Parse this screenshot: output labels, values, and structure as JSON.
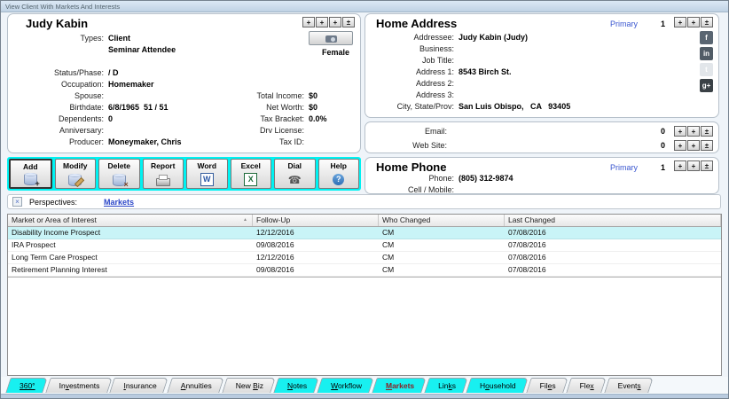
{
  "window": {
    "title": "View Client With Markets And Interests"
  },
  "colors": {
    "toolbar_bg": "#00f2f2",
    "tab_highlight": "#18f0f0",
    "selected_row_bg": "#c9f4f7",
    "primary_link": "#3b57d0",
    "perspective_link": "#2b46c8",
    "markets_tab_text": "#8b1f24"
  },
  "client": {
    "name": "Judy Kabin",
    "gender": "Female",
    "rows": [
      {
        "l1": "Types:",
        "v1": "Client"
      },
      {
        "l1": "",
        "v1": "Seminar Attendee"
      },
      {
        "spacer": true
      },
      {
        "l1": "Status/Phase:",
        "v1": "/ D"
      },
      {
        "l1": "Occupation:",
        "v1": "Homemaker"
      },
      {
        "l1": "Spouse:",
        "v1": "",
        "l2": "Total Income:",
        "v2": "$0"
      },
      {
        "l1": "Birthdate:",
        "v1": "6/8/1965  51 / 51",
        "l2": "Net Worth:",
        "v2": "$0"
      },
      {
        "l1": "Dependents:",
        "v1": "0",
        "l2": "Tax Bracket:",
        "v2": "0.0%"
      },
      {
        "l1": "Anniversary:",
        "v1": "",
        "l2": "Drv License:",
        "v2": ""
      },
      {
        "l1": "Producer:",
        "v1": "Moneymaker, Chris",
        "l2": "Tax ID:",
        "v2": ""
      }
    ]
  },
  "nav4": [
    "+",
    "+",
    "+",
    "±"
  ],
  "nav3": [
    "+",
    "+",
    "±"
  ],
  "home_address": {
    "title": "Home Address",
    "primary": "Primary",
    "count": "1",
    "fields": [
      {
        "label": "Addressee:",
        "value": "Judy Kabin (Judy)"
      },
      {
        "label": "Business:",
        "value": ""
      },
      {
        "label": "Job Title:",
        "value": ""
      },
      {
        "label": "Address 1:",
        "value": "8543 Birch St."
      },
      {
        "label": "Address 2:",
        "value": ""
      },
      {
        "label": "Address 3:",
        "value": ""
      },
      {
        "label": "City, State/Prov:",
        "value": "San Luis Obispo,   CA   93405"
      }
    ],
    "social": [
      {
        "name": "facebook-icon",
        "glyph": "f",
        "bg": "#5a6672",
        "fg": "#ffffff",
        "disabled": false
      },
      {
        "name": "linkedin-icon",
        "glyph": "in",
        "bg": "#515c66",
        "fg": "#ffffff",
        "disabled": false
      },
      {
        "name": "twitter-icon",
        "glyph": "t",
        "bg": "#dfe4e8",
        "fg": "#ffffff",
        "disabled": true
      },
      {
        "name": "googleplus-icon",
        "glyph": "g+",
        "bg": "#3a4146",
        "fg": "#ffffff",
        "disabled": false
      }
    ]
  },
  "contact_rows": [
    {
      "label": "Email:",
      "count": "0"
    },
    {
      "label": "Web Site:",
      "count": "0"
    }
  ],
  "home_phone": {
    "title": "Home Phone",
    "primary": "Primary",
    "count": "1",
    "fields": [
      {
        "label": "Phone:",
        "value": "(805) 312-9874"
      },
      {
        "label": "Cell / Mobile:",
        "value": ""
      }
    ]
  },
  "toolbar": [
    {
      "label": "Add",
      "icon": "db",
      "badge": "+",
      "default": true
    },
    {
      "label": "Modify",
      "icon": "db",
      "badge": "pencil",
      "default": false
    },
    {
      "label": "Delete",
      "icon": "db",
      "badge": "×",
      "default": false
    },
    {
      "label": "Report",
      "icon": "printer",
      "default": false
    },
    {
      "label": "Word",
      "icon": "word",
      "glyph": "W",
      "default": false
    },
    {
      "label": "Excel",
      "icon": "excel",
      "glyph": "X",
      "default": false
    },
    {
      "label": "Dial",
      "icon": "dial",
      "glyph": "☎",
      "default": false
    },
    {
      "label": "Help",
      "icon": "help",
      "glyph": "?",
      "default": false
    }
  ],
  "perspectives": {
    "label": "Perspectives:",
    "link": "Markets",
    "toggle_glyph": "×"
  },
  "markets_table": {
    "columns": [
      "Market or Area of Interest",
      "Follow-Up",
      "Who Changed",
      "Last Changed"
    ],
    "sorted_column": 0,
    "sort_direction": "asc",
    "sort_glyph": "▲",
    "selected_row": 0,
    "rows": [
      [
        "Disability Income Prospect",
        "12/12/2016",
        "CM",
        "07/08/2016"
      ],
      [
        "IRA Prospect",
        "09/08/2016",
        "CM",
        "07/08/2016"
      ],
      [
        "Long Term Care Prospect",
        "12/12/2016",
        "CM",
        "07/08/2016"
      ],
      [
        "Retirement Planning Interest",
        "09/08/2016",
        "CM",
        "07/08/2016"
      ]
    ]
  },
  "tabs": [
    {
      "pre": "",
      "key": "360°",
      "post": "",
      "highlight": true,
      "active": false
    },
    {
      "pre": "In",
      "key": "v",
      "post": "estments",
      "highlight": false,
      "active": false
    },
    {
      "pre": "",
      "key": "I",
      "post": "nsurance",
      "highlight": false,
      "active": false
    },
    {
      "pre": "",
      "key": "A",
      "post": "nnuities",
      "highlight": false,
      "active": false
    },
    {
      "pre": "New ",
      "key": "B",
      "post": "iz",
      "highlight": false,
      "active": false
    },
    {
      "pre": "",
      "key": "N",
      "post": "otes",
      "highlight": true,
      "active": false
    },
    {
      "pre": "",
      "key": "W",
      "post": "orkflow",
      "highlight": true,
      "active": false
    },
    {
      "pre": "",
      "key": "M",
      "post": "arkets",
      "highlight": true,
      "active": true
    },
    {
      "pre": "Lin",
      "key": "k",
      "post": "s",
      "highlight": true,
      "active": false
    },
    {
      "pre": "H",
      "key": "o",
      "post": "usehold",
      "highlight": true,
      "active": false
    },
    {
      "pre": "Fil",
      "key": "e",
      "post": "s",
      "highlight": false,
      "active": false
    },
    {
      "pre": "Fle",
      "key": "x",
      "post": "",
      "highlight": false,
      "active": false
    },
    {
      "pre": "Event",
      "key": "s",
      "post": "",
      "highlight": false,
      "active": false
    }
  ]
}
